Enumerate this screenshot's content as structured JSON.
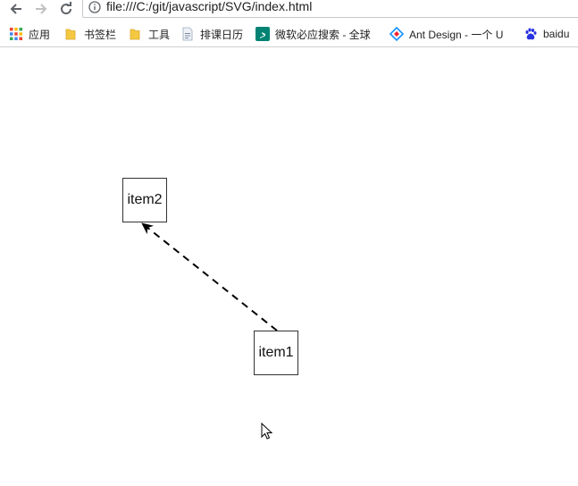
{
  "browser": {
    "url": "file:///C:/git/javascript/SVG/index.html",
    "bookmarks": [
      {
        "label": "应用",
        "icon": "apps-grid-icon"
      },
      {
        "label": "书签栏",
        "icon": "folder-icon"
      },
      {
        "label": "工具",
        "icon": "folder-icon"
      },
      {
        "label": "排课日历",
        "icon": "page-icon"
      },
      {
        "label": "微软必应搜索 - 全球",
        "icon": "bing-icon"
      },
      {
        "label": "Ant Design - 一个 U",
        "icon": "ant-design-icon"
      },
      {
        "label": "baidu",
        "icon": "baidu-paw-icon"
      }
    ]
  },
  "diagram": {
    "nodes": [
      {
        "id": "item2",
        "label": "item2"
      },
      {
        "id": "item1",
        "label": "item1"
      }
    ],
    "edge": {
      "from": "item1",
      "to": "item2",
      "style": "dashed",
      "arrow": "end"
    }
  },
  "colors": {
    "accent_bing": "#008373",
    "folder": "#f5c842",
    "ant_design": "#1890ff",
    "baidu": "#2932e1"
  }
}
